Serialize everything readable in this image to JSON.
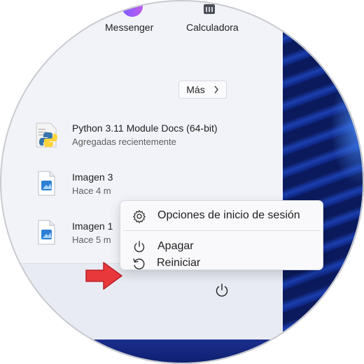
{
  "pinned_apps": [
    {
      "label": "Messenger",
      "icon": "messenger-icon"
    },
    {
      "label": "Calculadora",
      "icon": "calculator-icon"
    }
  ],
  "more_button": {
    "label": "Más",
    "icon": "chevron-right-icon"
  },
  "recommended": [
    {
      "title": "Python 3.11 Module Docs (64-bit)",
      "subtitle": "Agregadas recientemente",
      "icon": "python-docs-icon"
    },
    {
      "title": "Imagen 3",
      "subtitle": "Hace 4 m",
      "icon": "image-file-icon"
    },
    {
      "title": "Imagen 1",
      "subtitle": "Hace 5 m",
      "icon": "image-file-icon"
    }
  ],
  "power_menu": {
    "items": [
      {
        "label": "Opciones de inicio de sesión",
        "icon": "gear-icon"
      },
      {
        "label": "Apagar",
        "icon": "power-icon"
      },
      {
        "label": "Reiniciar",
        "icon": "restart-icon"
      }
    ]
  },
  "colors": {
    "annotation_arrow": "#e8383c",
    "accent_wallpaper": "#1b3fb0"
  }
}
